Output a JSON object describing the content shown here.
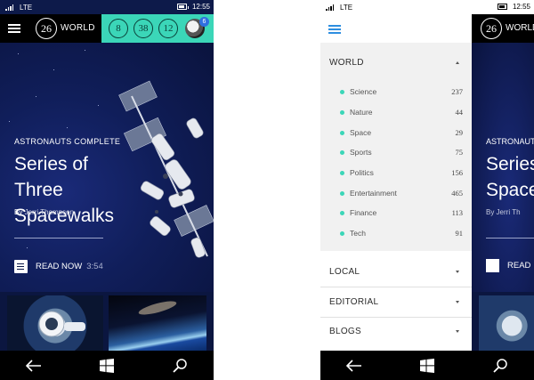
{
  "status_bar": {
    "network": "LTE",
    "time": "12:55"
  },
  "header": {
    "date_number": "26",
    "section": "WORLD",
    "stats": [
      "8",
      "38",
      "12"
    ],
    "notification_count": "6"
  },
  "hero": {
    "kicker": "ASTRONAUTS COMPLETE",
    "title": "Series of Three Spacewalks",
    "by_label": "By",
    "author": "Jerri Thompson",
    "read_label": "READ NOW",
    "duration": "3:54"
  },
  "peek": {
    "kicker": "ASTRONAUTS C",
    "title_line1": "Series",
    "title_line2": "Spacew",
    "byline": "By Jerri Th",
    "read_label": "READ"
  },
  "menu": {
    "world_label": "WORLD",
    "world_items": [
      {
        "label": "Science",
        "count": "237"
      },
      {
        "label": "Nature",
        "count": "44"
      },
      {
        "label": "Space",
        "count": "29"
      },
      {
        "label": "Sports",
        "count": "75"
      },
      {
        "label": "Politics",
        "count": "156"
      },
      {
        "label": "Entertainment",
        "count": "465"
      },
      {
        "label": "Finance",
        "count": "113"
      },
      {
        "label": "Tech",
        "count": "91"
      }
    ],
    "sections": [
      "LOCAL",
      "EDITORIAL",
      "BLOGS"
    ]
  },
  "icons": {
    "back": "back-arrow-icon",
    "home": "windows-logo-icon",
    "search": "search-icon"
  },
  "colors": {
    "accent": "#3bd6b8",
    "header_bg": "#000000",
    "hero_bg": "#0d1a4a",
    "menu_bg": "#f1f1f1",
    "menu_icon": "#2d8ee0"
  }
}
